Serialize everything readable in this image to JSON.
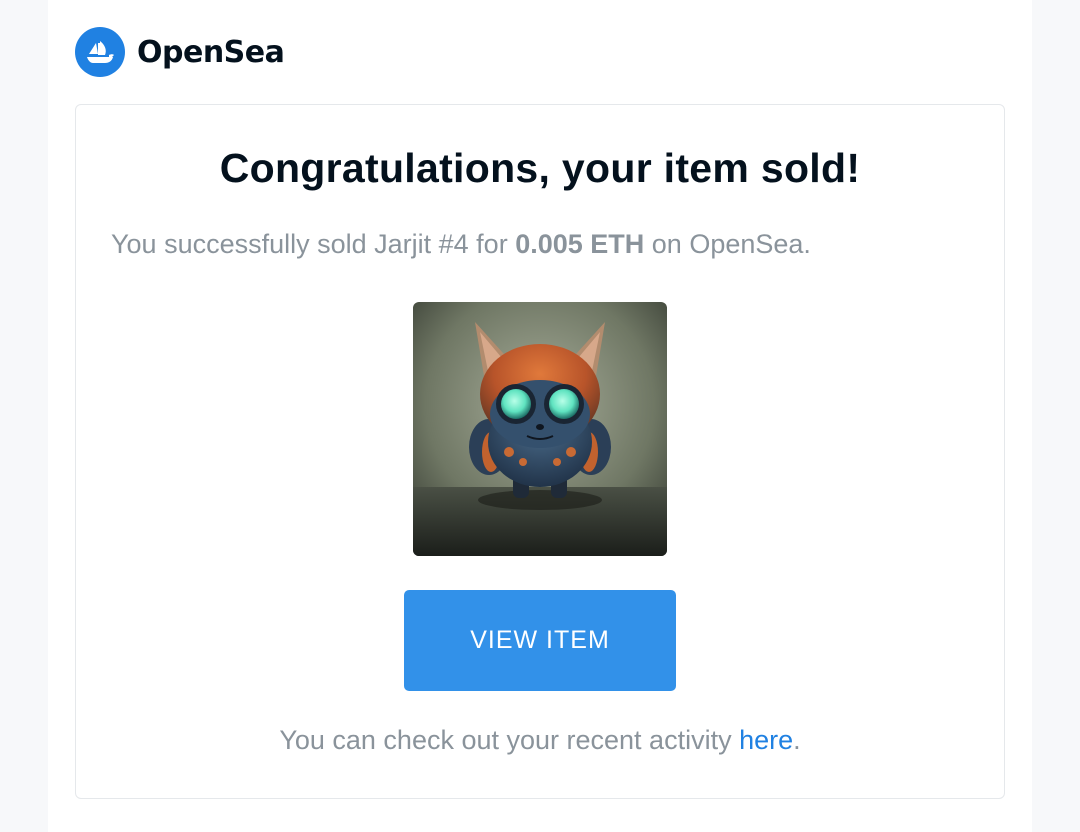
{
  "header": {
    "logo_icon": "opensea-boat-icon",
    "brand_name": "OpenSea",
    "brand_color": "#2081e2"
  },
  "card": {
    "title": "Congratulations, your item sold!",
    "message": {
      "prefix": "You successfully sold Jarjit #4 for ",
      "price": "0.005 ETH",
      "suffix": " on OpenSea."
    },
    "image_subject": "fuzzy creature NFT artwork",
    "button_label": "VIEW ITEM",
    "button_color": "#3291e9",
    "footer": {
      "text": "You can check out your recent activity ",
      "link_label": "here",
      "trailing": "."
    }
  }
}
